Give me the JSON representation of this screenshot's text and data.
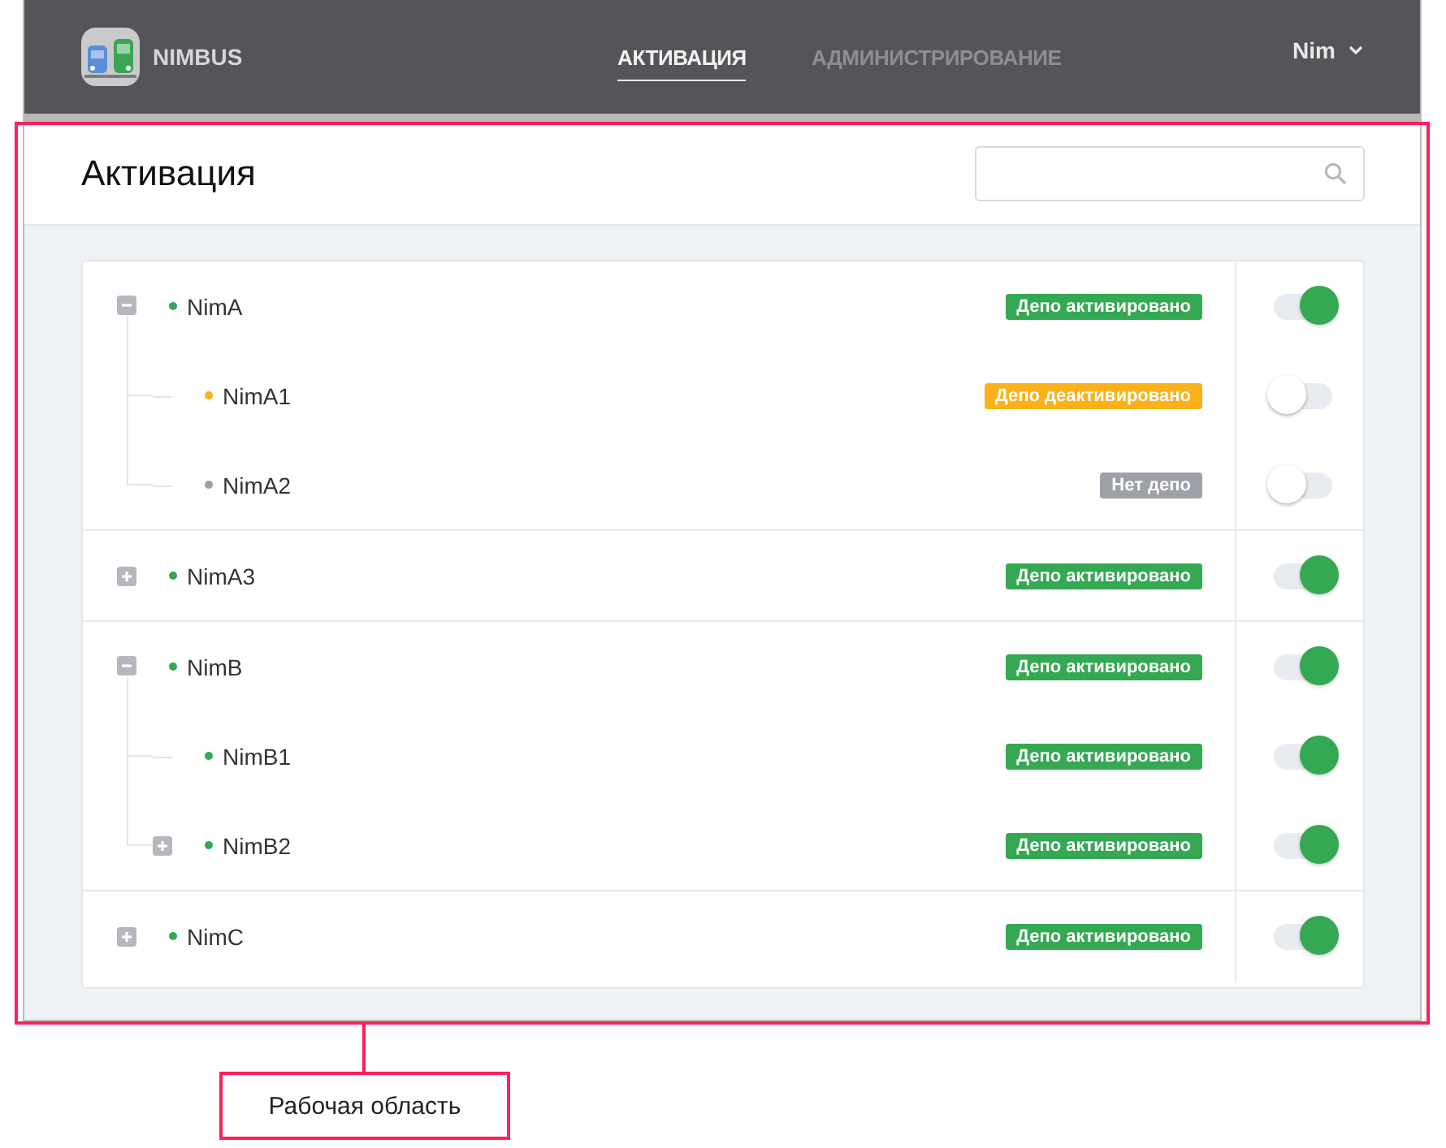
{
  "header": {
    "logo": "NIMBUS",
    "tabs": [
      {
        "label": "АКТИВАЦИЯ",
        "selected": true
      },
      {
        "label": "АДМИНИСТРИРОВАНИЕ",
        "selected": false
      }
    ],
    "user": "Nim"
  },
  "page": {
    "title": "Активация"
  },
  "tree": [
    {
      "name": "NimA",
      "color": "#34a853",
      "status": {
        "label": "Депо активировано",
        "kind": "active"
      },
      "on": true,
      "expanded": true,
      "children": [
        {
          "name": "NimA1",
          "color": "#fbb117",
          "status": {
            "label": "Депо деактивировано",
            "kind": "inactive"
          },
          "on": false
        },
        {
          "name": "NimA2",
          "color": "#9ea0a8",
          "status": {
            "label": "Нет депо",
            "kind": "none"
          },
          "on": false
        }
      ]
    },
    {
      "name": "NimA3",
      "color": "#34a853",
      "status": {
        "label": "Депо активировано",
        "kind": "active"
      },
      "on": true,
      "expanded": false
    },
    {
      "name": "NimB",
      "color": "#34a853",
      "status": {
        "label": "Депо активировано",
        "kind": "active"
      },
      "on": true,
      "expanded": true,
      "children": [
        {
          "name": "NimB1",
          "color": "#34a853",
          "status": {
            "label": "Депо активировано",
            "kind": "active"
          },
          "on": true
        },
        {
          "name": "NimB2",
          "color": "#34a853",
          "status": {
            "label": "Депо активировано",
            "kind": "active"
          },
          "on": true,
          "expanded": false
        }
      ]
    },
    {
      "name": "NimC",
      "color": "#34a853",
      "status": {
        "label": "Депо активировано",
        "kind": "active"
      },
      "on": true,
      "expanded": false
    }
  ],
  "callout": {
    "label": "Рабочая область"
  }
}
